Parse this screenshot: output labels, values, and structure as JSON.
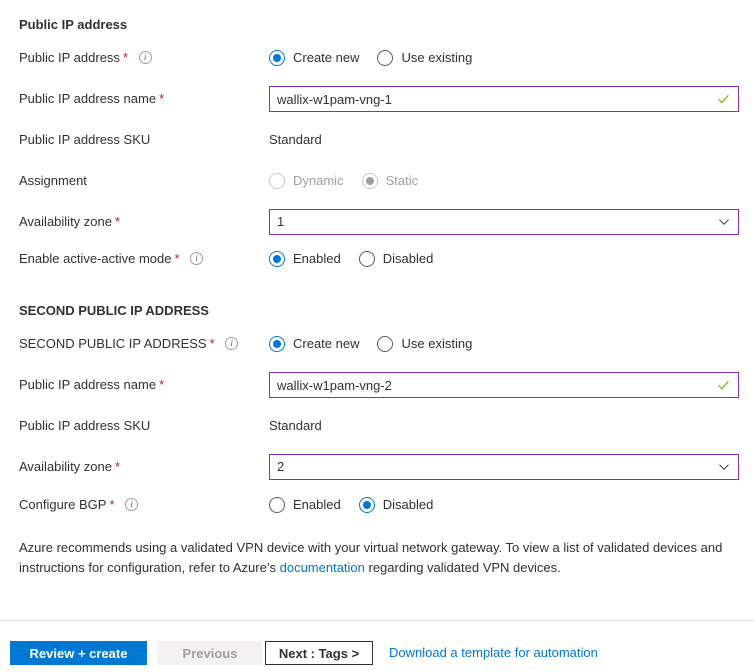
{
  "section1": {
    "heading": "Public IP address",
    "rows": {
      "public_ip_address": {
        "label": "Public IP address",
        "required": "*",
        "options": [
          "Create new",
          "Use existing"
        ],
        "selected": "Create new"
      },
      "public_ip_address_name": {
        "label": "Public IP address name",
        "required": "*",
        "value": "wallix-w1pam-vng-1",
        "placeholder": ""
      },
      "public_ip_address_sku": {
        "label": "Public IP address SKU",
        "value": "Standard"
      },
      "assignment": {
        "label": "Assignment",
        "options": [
          "Dynamic",
          "Static"
        ],
        "selected": "Static",
        "disabled": true
      },
      "availability_zone": {
        "label": "Availability zone",
        "required": "*",
        "value": "1"
      },
      "enable_active_active_mode": {
        "label": "Enable active-active mode",
        "required": "*",
        "options": [
          "Enabled",
          "Disabled"
        ],
        "selected": "Enabled"
      }
    }
  },
  "section2": {
    "heading": "SECOND PUBLIC IP ADDRESS",
    "rows": {
      "second_public_ip_address": {
        "label": "SECOND PUBLIC IP ADDRESS",
        "required": "*",
        "options": [
          "Create new",
          "Use existing"
        ],
        "selected": "Create new"
      },
      "public_ip_address_name": {
        "label": "Public IP address name",
        "required": "*",
        "value": "wallix-w1pam-vng-2",
        "placeholder": ""
      },
      "public_ip_address_sku": {
        "label": "Public IP address SKU",
        "value": "Standard"
      },
      "availability_zone": {
        "label": "Availability zone",
        "required": "*",
        "value": "2"
      },
      "configure_bgp": {
        "label": "Configure BGP",
        "required": "*",
        "options": [
          "Enabled",
          "Disabled"
        ],
        "selected": "Disabled"
      }
    }
  },
  "note": {
    "text_before": "Azure recommends using a validated VPN device with your virtual network gateway. To view a list of validated devices and instructions for configuration, refer to Azure’s ",
    "link_text": "documentation",
    "text_after": " regarding validated VPN devices."
  },
  "footer": {
    "review_create": "Review + create",
    "previous": "Previous",
    "next": "Next : Tags >",
    "download_template": "Download a template for automation"
  },
  "colors": {
    "accent": "#0078d4",
    "required_asterisk": "#a4262c",
    "input_border": "#8b2fa8",
    "valid_check": "#7fba00",
    "link": "#0078d4"
  }
}
